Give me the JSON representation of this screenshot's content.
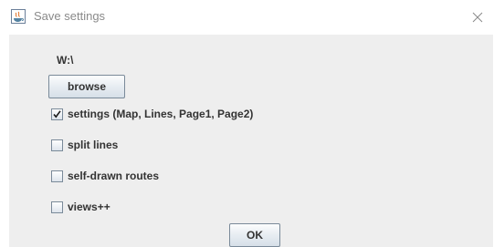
{
  "window": {
    "title": "Save settings",
    "icon": "java-app-icon",
    "close_icon": "close-icon"
  },
  "form": {
    "path": "W:\\",
    "browse_label": "browse",
    "ok_label": "OK",
    "options": [
      {
        "label": "settings (Map, Lines, Page1, Page2)",
        "checked": true
      },
      {
        "label": "split lines",
        "checked": false
      },
      {
        "label": "self-drawn routes",
        "checked": false
      },
      {
        "label": "views++",
        "checked": false
      }
    ]
  }
}
